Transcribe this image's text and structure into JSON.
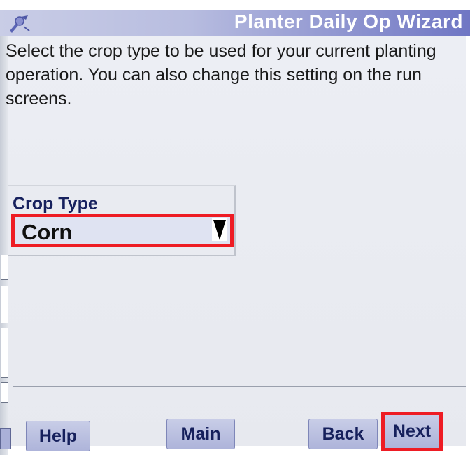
{
  "header": {
    "title": "Planter Daily Op Wizard",
    "icon": "planter-wrench-icon"
  },
  "instructions": {
    "text": "Select the crop type to be used for your current planting operation. You can also change this setting on the run screens."
  },
  "crop_type": {
    "label": "Crop Type",
    "selected_value": "Corn",
    "highlight_color": "#ee1c24"
  },
  "buttons": {
    "help": "Help",
    "main": "Main",
    "back": "Back",
    "next": "Next"
  },
  "colors": {
    "title_bar_end": "#6f76c4",
    "button_fill": "#b8bde0",
    "label_text": "#17215e"
  }
}
